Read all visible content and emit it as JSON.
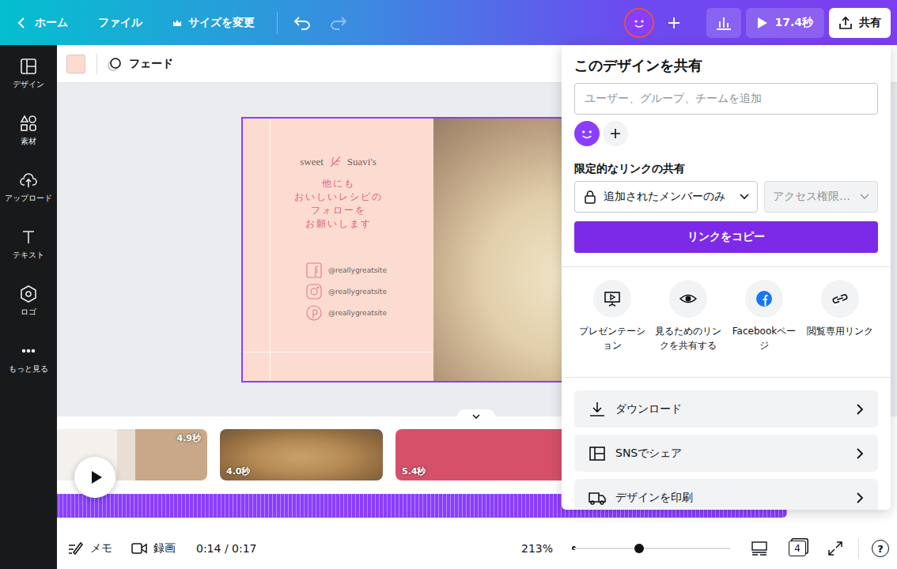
{
  "topbar": {
    "home": "ホーム",
    "file": "ファイル",
    "resize": "サイズを変更",
    "undo_disabled": false,
    "redo_disabled": true,
    "avatar_selected": true,
    "play": "17.4秒",
    "share": "共有"
  },
  "sidebar": {
    "items": [
      {
        "label": "デザイン",
        "kind": "design"
      },
      {
        "label": "素材",
        "kind": "elements"
      },
      {
        "label": "アップロード",
        "kind": "upload"
      },
      {
        "label": "テキスト",
        "kind": "text"
      },
      {
        "label": "ロゴ",
        "kind": "logo"
      },
      {
        "label": "もっと見る",
        "kind": "more"
      }
    ]
  },
  "toolbar": {
    "color": "#fcdcd0",
    "effect": "フェード"
  },
  "slide": {
    "brand": [
      "sweet",
      "Suavi's"
    ],
    "message": [
      "他にも",
      "おいしいレシピの",
      "フォローを",
      "お願いします"
    ],
    "socials": [
      {
        "kind": "facebook",
        "handle": "@reallygreatsite"
      },
      {
        "kind": "instagram",
        "handle": "@reallygreatsite"
      },
      {
        "kind": "pinterest",
        "handle": "@reallygreatsite"
      }
    ]
  },
  "share_panel": {
    "title": "このデザインを共有",
    "invite_placeholder": "ユーザー、グループ、チームを追加",
    "link_heading": "限定的なリンクの共有",
    "access": {
      "value": "追加されたメンバーのみ"
    },
    "permission": {
      "value": "アクセス権限…",
      "disabled": true
    },
    "copy_button": "リンクをコピー",
    "options": [
      {
        "kind": "present",
        "label": "プレゼンテーション"
      },
      {
        "kind": "view",
        "label": "見るためのリンクを共有する"
      },
      {
        "kind": "facebook",
        "label": "Facebookページ"
      },
      {
        "kind": "link",
        "label": "閲覧専用リンク"
      }
    ],
    "actions": [
      {
        "kind": "download",
        "label": "ダウンロード"
      },
      {
        "kind": "social",
        "label": "SNSでシェア"
      },
      {
        "kind": "print",
        "label": "デザインを印刷"
      }
    ]
  },
  "timeline": {
    "clips": [
      {
        "duration": "4.9秒",
        "kind": "strawberry"
      },
      {
        "duration": "4.0秒",
        "kind": "bowl"
      },
      {
        "duration": "5.4秒",
        "kind": "design"
      }
    ]
  },
  "bottombar": {
    "notes": "メモ",
    "record": "録画",
    "time": "0:14 / 0:17",
    "zoom": "213%",
    "zoom_level": 0.42,
    "pages": "4",
    "help": "?"
  }
}
